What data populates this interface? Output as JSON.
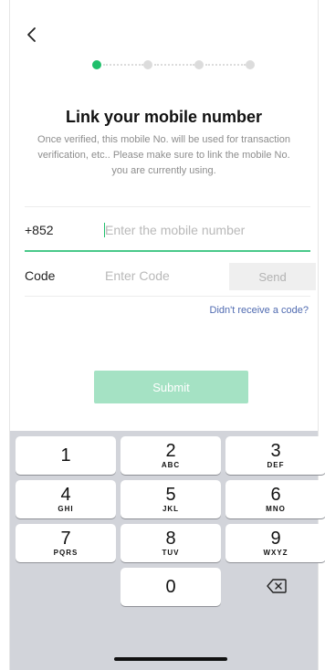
{
  "header": {
    "back_icon": "chevron-left-icon"
  },
  "stepper": {
    "total_steps": 4,
    "current_step": 1,
    "active_color": "#1fbf6b",
    "inactive_color": "#dcdcdc"
  },
  "page": {
    "title": "Link your mobile number",
    "subtitle": "Once verified, this mobile No. will be used for transaction verification, etc.. Please make sure to link the mobile No. you are currently using."
  },
  "form": {
    "country_code": "+852",
    "mobile_placeholder": "Enter the mobile number",
    "mobile_value": "",
    "code_label": "Code",
    "code_placeholder": "Enter Code",
    "code_value": "",
    "send_label": "Send",
    "resend_link": "Didn't receive a code?",
    "submit_label": "Submit"
  },
  "keypad": {
    "keys": [
      {
        "digit": "1",
        "letters": ""
      },
      {
        "digit": "2",
        "letters": "ABC"
      },
      {
        "digit": "3",
        "letters": "DEF"
      },
      {
        "digit": "4",
        "letters": "GHI"
      },
      {
        "digit": "5",
        "letters": "JKL"
      },
      {
        "digit": "6",
        "letters": "MNO"
      },
      {
        "digit": "7",
        "letters": "PQRS"
      },
      {
        "digit": "8",
        "letters": "TUV"
      },
      {
        "digit": "9",
        "letters": "WXYZ"
      },
      {
        "digit": "0",
        "letters": ""
      }
    ],
    "delete_icon": "backspace-icon"
  },
  "colors": {
    "accent": "#1fbf6b",
    "submit_disabled": "#a5e2c4",
    "link": "#506bb1"
  }
}
